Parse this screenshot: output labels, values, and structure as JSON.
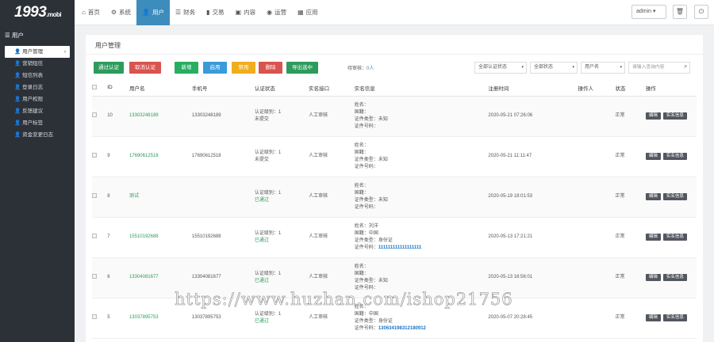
{
  "logo": {
    "main": "1993",
    "sub": ".mobi"
  },
  "nav": [
    {
      "label": "首页",
      "icon": "home-icon",
      "glyph": "⌂"
    },
    {
      "label": "系统",
      "icon": "gear-icon",
      "glyph": "⚙"
    },
    {
      "label": "用户",
      "icon": "user-icon",
      "glyph": "👤"
    },
    {
      "label": "财务",
      "icon": "list-icon",
      "glyph": "☰"
    },
    {
      "label": "交易",
      "icon": "chart-icon",
      "glyph": "▮"
    },
    {
      "label": "内容",
      "icon": "doc-icon",
      "glyph": "▣"
    },
    {
      "label": "运营",
      "icon": "globe-icon",
      "glyph": "◉"
    },
    {
      "label": "应用",
      "icon": "apps-icon",
      "glyph": "▦"
    }
  ],
  "admin": {
    "label": "admin"
  },
  "sidebar": {
    "title": "用户",
    "items": [
      "用户管理",
      "营销短信",
      "短信列表",
      "登录日志",
      "用户权限",
      "反馈建议",
      "用户标签",
      "资金变更日志"
    ]
  },
  "panel": {
    "title": "用户管理"
  },
  "buttons": [
    {
      "label": "通过认证",
      "color": "#2e9b5b"
    },
    {
      "label": "取消认证",
      "color": "#d9534f"
    },
    {
      "label": "新增",
      "color": "#27ae60"
    },
    {
      "label": "启用",
      "color": "#3b9ad9"
    },
    {
      "label": "禁用",
      "color": "#f0ad1e"
    },
    {
      "label": "删除",
      "color": "#d9534f"
    },
    {
      "label": "导出选中",
      "color": "#2e9b5b"
    }
  ],
  "stat": {
    "label": "待审核：",
    "value": "0人"
  },
  "filters": {
    "status": "全部认证状态",
    "all": "全部状态",
    "field": "用户名",
    "search_placeholder": "请输入查询内容"
  },
  "columns": [
    "ID",
    "用户名",
    "手机号",
    "认证状态",
    "实名接口",
    "实名信息",
    "注册时间",
    "操作人",
    "状态",
    "操作"
  ],
  "info_labels": {
    "name": "姓名：",
    "country": "国籍：",
    "idtype": "证件类型：",
    "idno": "证件号码："
  },
  "auth_labels": {
    "level": "认证级别：",
    "pending": "未提交",
    "passed": "已通过"
  },
  "row_buttons": {
    "edit": "编辑",
    "real": "实名信息"
  },
  "rows": [
    {
      "id": "10",
      "user": "13303248189",
      "phone": "13303248189",
      "level": "1",
      "auth": "未提交",
      "authok": false,
      "iface": "人工审核",
      "name": "",
      "country": "",
      "idtype": "未知",
      "idno": "",
      "time": "2020-05-21 07:26:06",
      "op": "",
      "status": "正常"
    },
    {
      "id": "9",
      "user": "17690612518",
      "phone": "17690612518",
      "level": "1",
      "auth": "未提交",
      "authok": false,
      "iface": "人工审核",
      "name": "",
      "country": "",
      "idtype": "未知",
      "idno": "",
      "time": "2020-05-21 11:11:47",
      "op": "",
      "status": "正常"
    },
    {
      "id": "8",
      "user": "测试",
      "phone": "",
      "level": "1",
      "auth": "已通过",
      "authok": true,
      "iface": "人工审核",
      "name": "",
      "country": "",
      "idtype": "未知",
      "idno": "",
      "time": "2020-05-19 18:01:53",
      "op": "",
      "status": "正常"
    },
    {
      "id": "7",
      "user": "15510192688",
      "phone": "15510192688",
      "level": "1",
      "auth": "已通过",
      "authok": true,
      "iface": "人工审核",
      "name": "刘洋",
      "country": "中国",
      "idtype": "身份证",
      "idno": "111111111111111111",
      "time": "2020-05-13 17:21:21",
      "op": "",
      "status": "正常"
    },
    {
      "id": "6",
      "user": "13304081677",
      "phone": "13304081677",
      "level": "1",
      "auth": "已通过",
      "authok": true,
      "iface": "人工审核",
      "name": "",
      "country": "",
      "idtype": "未知",
      "idno": "",
      "time": "2020-05-13 16:56:01",
      "op": "",
      "status": "正常"
    },
    {
      "id": "5",
      "user": "13037895753",
      "phone": "13037895753",
      "level": "1",
      "auth": "已通过",
      "authok": true,
      "iface": "人工审核",
      "name": "",
      "country": "中国",
      "idtype": "身份证",
      "idno": "130634198312180912",
      "time": "2020-05-07 20:28:45",
      "op": "",
      "status": "正常"
    }
  ],
  "watermark": "https://www.huzhan.com/ishop21756"
}
